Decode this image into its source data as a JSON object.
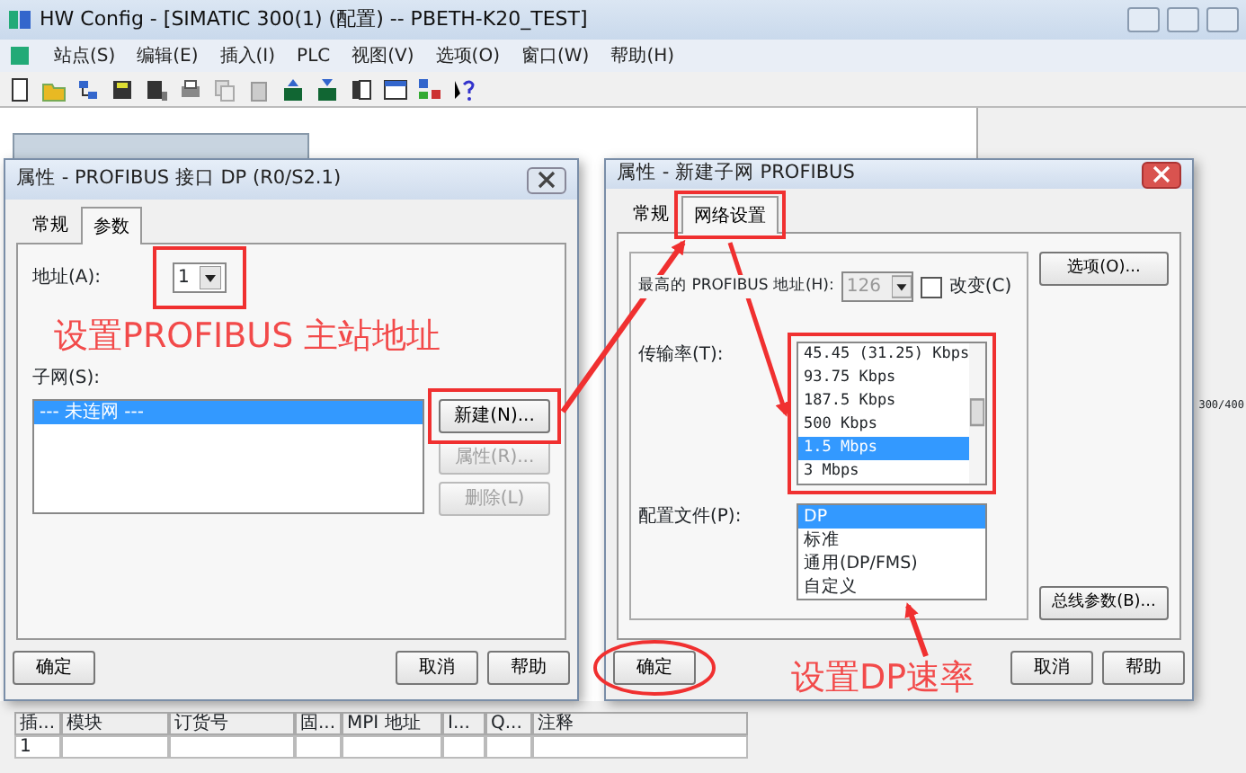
{
  "window": {
    "title": "HW Config - [SIMATIC 300(1) (配置) -- PBETH-K20_TEST]"
  },
  "menu": [
    "站点(S)",
    "编辑(E)",
    "插入(I)",
    "PLC",
    "视图(V)",
    "选项(O)",
    "窗口(W)",
    "帮助(H)"
  ],
  "catalog_text": "300/400",
  "module_table": {
    "columns": [
      "插...",
      "模块",
      "订货号",
      "固...",
      "MPI 地址",
      "I...",
      "Q...",
      "注释"
    ],
    "rows": [
      [
        "1"
      ]
    ]
  },
  "interface_dialog": {
    "title": "属性 - PROFIBUS 接口  DP (R0/S2.1)",
    "tabs": [
      {
        "label": "常规",
        "selected": false
      },
      {
        "label": "参数",
        "selected": true
      }
    ],
    "address": {
      "label": "地址(A):",
      "value": "1"
    },
    "subnet": {
      "label": "子网(S):",
      "items": [
        {
          "label": "--- 未连网 ---",
          "selected": true
        }
      ]
    },
    "side_buttons": [
      {
        "label": "新建(N)...",
        "disabled": false
      },
      {
        "label": "属性(R)...",
        "disabled": true
      },
      {
        "label": "删除(L)",
        "disabled": true
      }
    ],
    "buttons": [
      "确定",
      "取消",
      "帮助"
    ]
  },
  "subnet_dialog": {
    "title": "属性 - 新建子网 PROFIBUS",
    "tabs": [
      {
        "label": "常规",
        "selected": false
      },
      {
        "label": "网络设置",
        "selected": true
      }
    ],
    "highest_address": {
      "label": "最高的 PROFIBUS 地址(H):",
      "value": "126",
      "disabled": true
    },
    "change_checkbox": {
      "label": "改变(C)",
      "checked": false
    },
    "options_button": "选项(O)...",
    "transmission_rate": {
      "label": "传输率(T):",
      "items": [
        {
          "label": "45.45 (31.25) Kbps",
          "selected": false
        },
        {
          "label": "93.75 Kbps",
          "selected": false
        },
        {
          "label": "187.5 Kbps",
          "selected": false
        },
        {
          "label": "500 Kbps",
          "selected": false
        },
        {
          "label": "1.5 Mbps",
          "selected": true
        },
        {
          "label": "3 Mbps",
          "selected": false
        }
      ]
    },
    "profile": {
      "label": "配置文件(P):",
      "items": [
        {
          "label": "DP",
          "selected": true
        },
        {
          "label": "标准",
          "selected": false
        },
        {
          "label": "通用(DP/FMS)",
          "selected": false
        },
        {
          "label": "自定义",
          "selected": false
        }
      ]
    },
    "bus_params_button": "总线参数(B)...",
    "buttons": [
      "确定",
      "取消",
      "帮助"
    ]
  },
  "annotations": [
    {
      "text": "设置PROFIBUS 主站地址"
    },
    {
      "text": "设置DP速率"
    }
  ]
}
